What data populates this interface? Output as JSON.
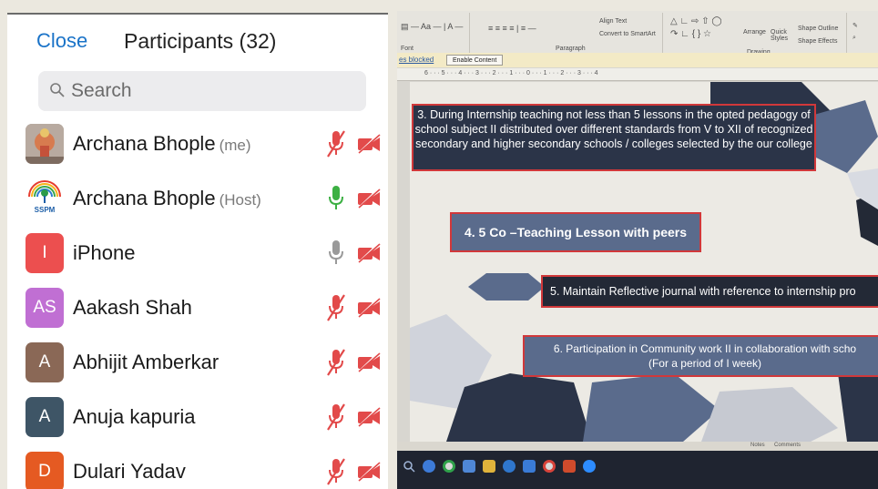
{
  "participants_panel": {
    "close_label": "Close",
    "title": "Participants (32)",
    "search_placeholder": "Search",
    "participants": [
      {
        "name": "Archana Bhople",
        "tag": "(me)",
        "avatar": "photo",
        "avatar_color": "#a9a19a",
        "mic": "muted",
        "video": "off"
      },
      {
        "name": "Archana Bhople",
        "tag": "(Host)",
        "avatar": "ssp-logo",
        "logo_text": "SSPM",
        "avatar_color": "#ffffff",
        "mic": "on",
        "video": "off"
      },
      {
        "name": "iPhone",
        "tag": "",
        "avatar_initials": "I",
        "avatar_color": "#ec4f4f",
        "mic": "idle",
        "video": "off"
      },
      {
        "name": "Aakash Shah",
        "tag": "",
        "avatar_initials": "AS",
        "avatar_color": "#c06fd3",
        "mic": "muted",
        "video": "off"
      },
      {
        "name": "Abhijit Amberkar",
        "tag": "",
        "avatar_initials": "A",
        "avatar_color": "#8a6856",
        "mic": "muted",
        "video": "off"
      },
      {
        "name": "Anuja kapuria",
        "tag": "",
        "avatar_initials": "A",
        "avatar_color": "#3e5566",
        "mic": "muted",
        "video": "off"
      },
      {
        "name": "Dulari Yadav",
        "tag": "",
        "avatar_initials": "D",
        "avatar_color": "#e55a22",
        "mic": "muted",
        "video": "off"
      }
    ],
    "colors": {
      "accent": "#1a73c8",
      "muted": "#e24a4a",
      "mic_on": "#3cb043",
      "mic_idle": "#9a9a9a"
    }
  },
  "shared_screen": {
    "ribbon": {
      "font_label": "Font",
      "paragraph_label": "Paragraph",
      "drawing_label": "Drawing",
      "align_text": "Align Text",
      "convert_smartart": "Convert to SmartArt",
      "arrange": "Arrange",
      "quick_styles": "Quick Styles",
      "shape_outline": "Shape Outline",
      "shape_effects": "Shape Effects"
    },
    "message_bar": {
      "blocked_text": "es blocked",
      "enable_button": "Enable Content"
    },
    "ruler_text": "6 · · · 5 · · · 4 · · · 3 · · · 2 · · · 1 · · · 0 · · · 1 · · · 2 · · · 3 · · · 4",
    "slide_items": [
      "3. During Internship teaching not less than 5 lessons in the opted pedagogy of school subject II  distributed over different standards from V to XII of recognized secondary and higher secondary schools / colleges selected by the  our college",
      "4. 5  Co –Teaching Lesson with peers",
      "5. Maintain Reflective journal with reference to internship pro",
      "6. Participation in Community work II in collaboration with scho\n(For a period of I week)"
    ],
    "status": {
      "notes": "Notes",
      "comments": "Comments"
    },
    "taskbar_icons": [
      "search-icon",
      "cortana-icon",
      "chrome-icon",
      "store-icon",
      "explorer-icon",
      "edge-icon",
      "mail-icon",
      "chrome-icon",
      "powerpoint-icon",
      "zoom-icon"
    ]
  }
}
